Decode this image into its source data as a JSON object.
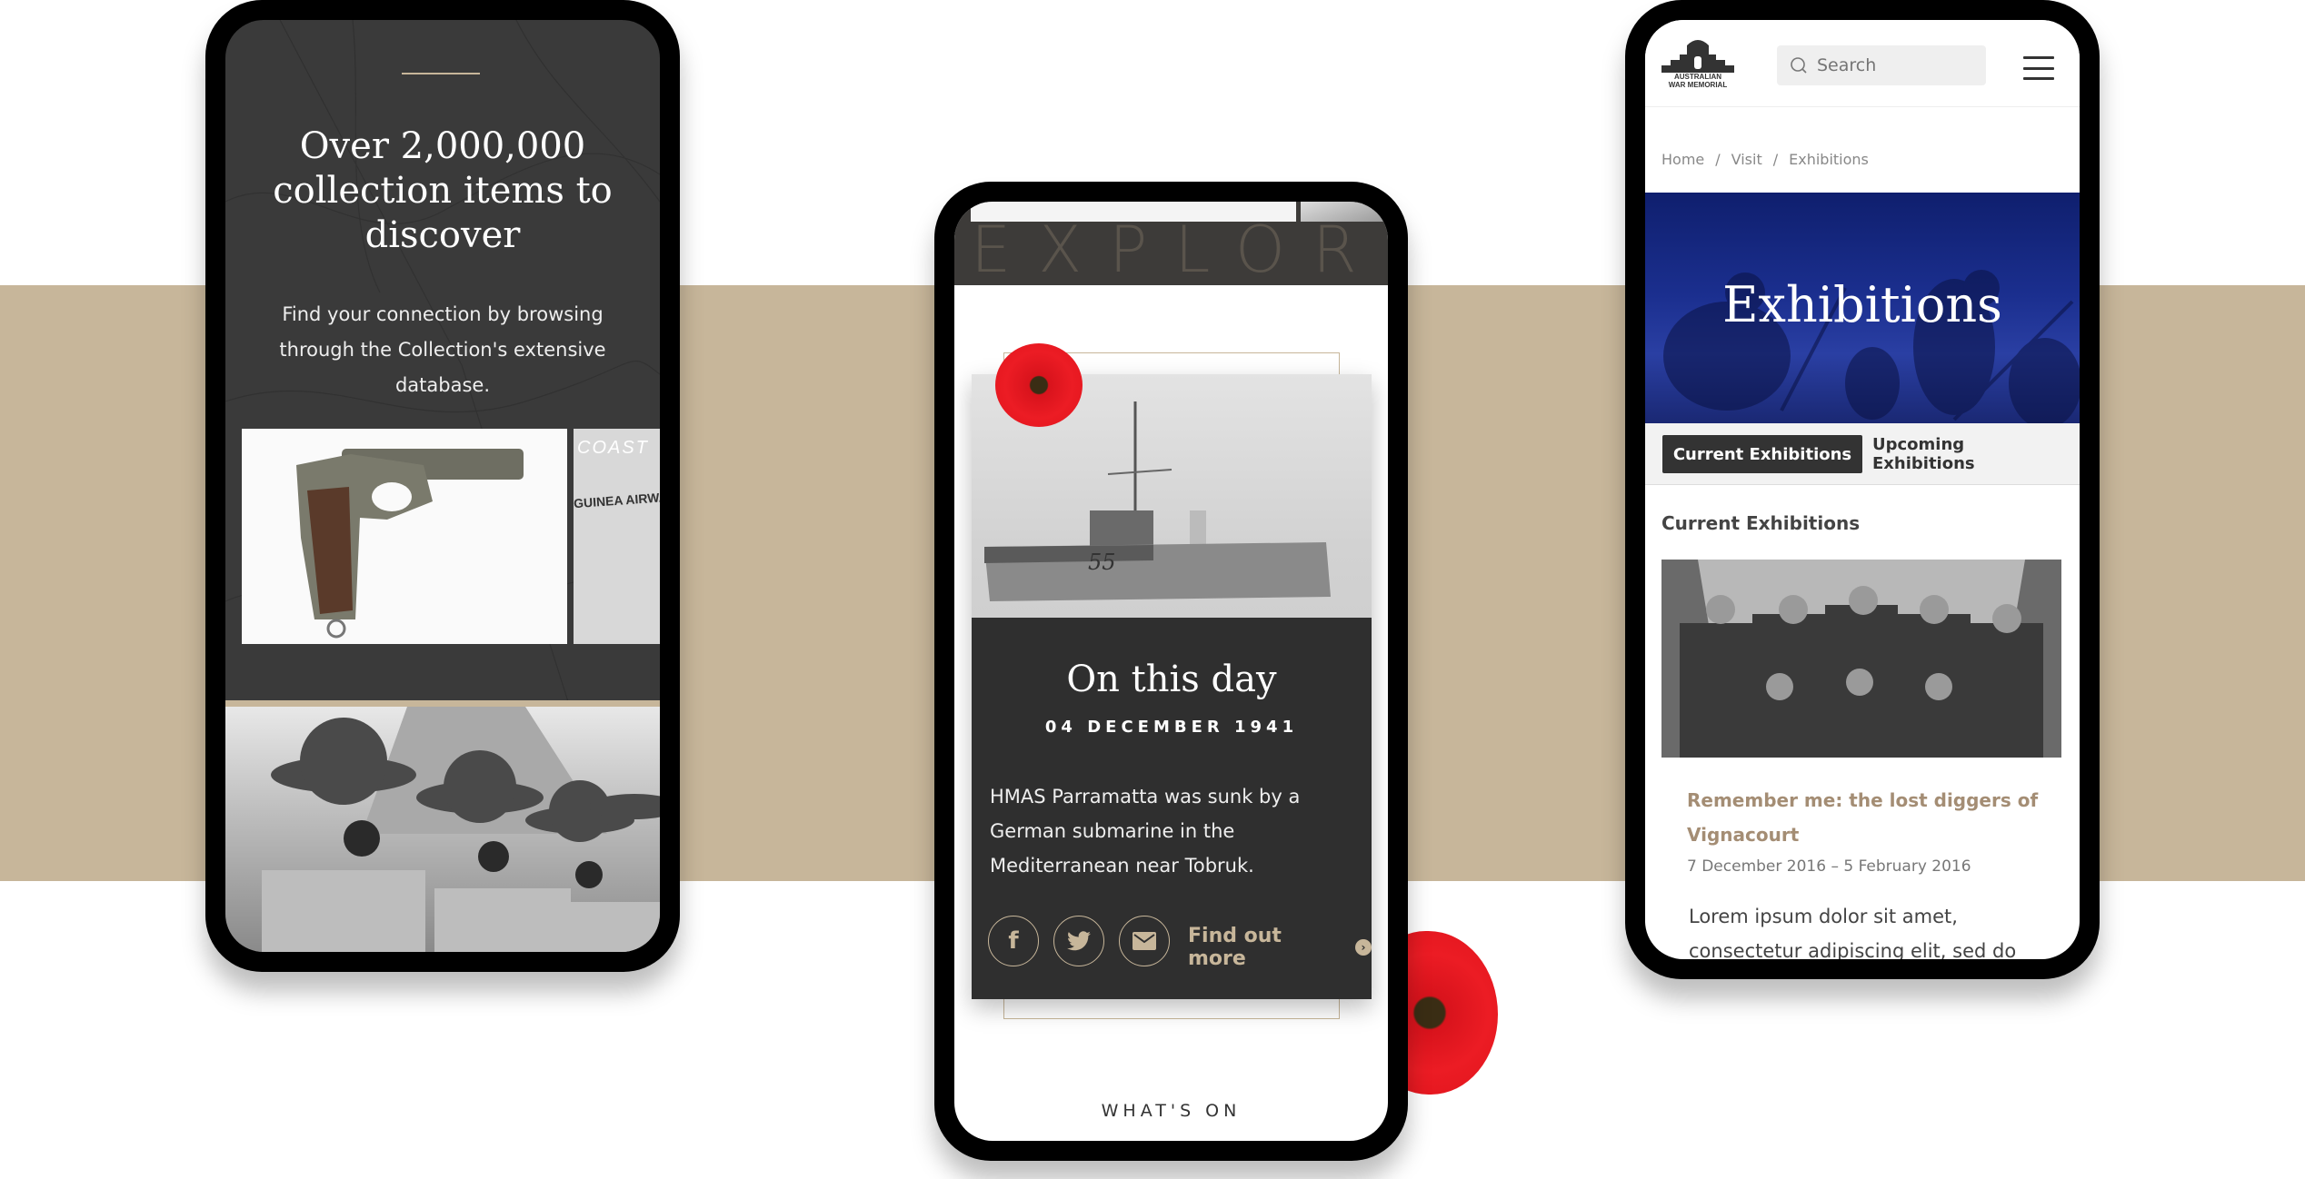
{
  "colors": {
    "band": "#c7b69a",
    "accent_gold": "#c7b69a",
    "dark_panel": "#2f2f2f",
    "hero_blue": "#1b2f8f",
    "exhibition_title": "#a48d74",
    "poppy_red": "#ec1c24"
  },
  "phone_collection": {
    "heading": "Over 2,000,000 collection items to discover",
    "subheading": "Find your connection by browsing through the Collection's extensive database.",
    "carousel": [
      {
        "label": "flare-pistol-photo"
      },
      {
        "label": "guinea-airways-photo",
        "visible_text": "GUINEA AIRWAYS",
        "visible_text_2": "COAST"
      }
    ],
    "feature_image": "soldiers-in-gas-masks-photo"
  },
  "phone_on_this_day": {
    "section_watermark": "EXPLORE",
    "card": {
      "title": "On this day",
      "date": "04 DECEMBER 1941",
      "text": "HMAS Parramatta was sunk by a German submarine in the Mediterranean near Tobruk.",
      "image": "hmas-parramatta-ship-photo",
      "ship_number": "55",
      "share": [
        {
          "icon": "facebook-icon",
          "glyph": "f"
        },
        {
          "icon": "twitter-icon",
          "glyph": "🐦"
        },
        {
          "icon": "email-icon",
          "glyph": "✉"
        }
      ],
      "cta_label": "Find out more",
      "cta_icon": "›"
    },
    "next_section": "WHAT'S ON"
  },
  "phone_exhibitions": {
    "logo_text_line1": "AUSTRALIAN",
    "logo_text_line2": "WAR MEMORIAL",
    "search_placeholder": "Search",
    "breadcrumb": [
      "Home",
      "/",
      "Visit",
      "/",
      "Exhibitions"
    ],
    "hero_title": "Exhibitions",
    "tabs": [
      {
        "label": "Current Exhibitions",
        "active": true
      },
      {
        "label": "Upcoming Exhibitions",
        "active": false
      }
    ],
    "section_title": "Current Exhibitions",
    "exhibition": {
      "title": "Remember me: the lost diggers of Vignacourt",
      "dates": "7 December 2016 – 5 February 2016",
      "description": "Lorem ipsum dolor sit amet, consectetur adipiscing elit, sed do"
    }
  }
}
